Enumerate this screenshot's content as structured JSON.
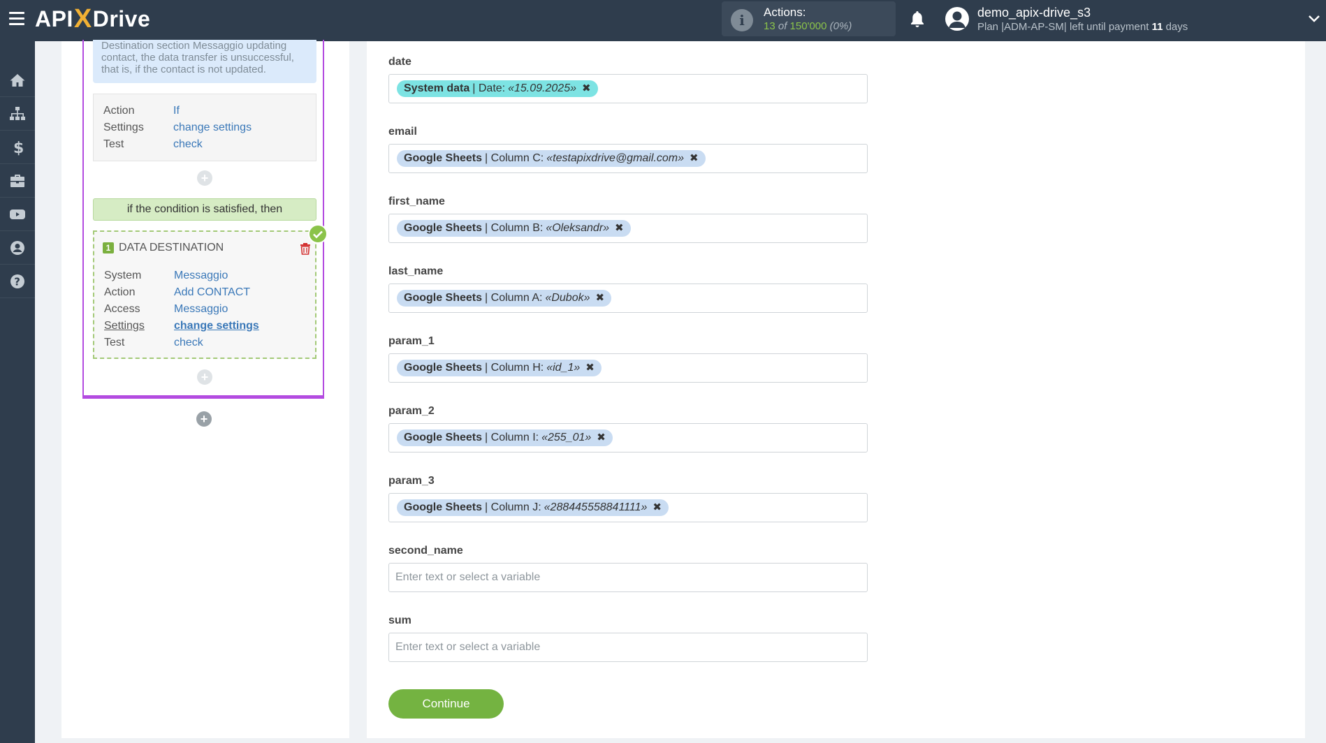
{
  "app": {
    "logo_main": "API",
    "logo_x": "X",
    "logo_tail": "Drive"
  },
  "header": {
    "actions_label": "Actions:",
    "actions_used": "13",
    "actions_of": "of",
    "actions_total": "150'000",
    "actions_pct": "(0%)",
    "user_name": "demo_apix-drive_s3",
    "plan_text": "Plan |ADM-AP-SM| left until payment",
    "plan_days": "11",
    "plan_days_suffix": "days"
  },
  "sidebar": {
    "items": [
      "home-icon",
      "sitemap-icon",
      "dollar-icon",
      "briefcase-icon",
      "youtube-icon",
      "user-icon",
      "help-icon"
    ]
  },
  "left_panel": {
    "note": "Destination section Messaggio updating contact, the data transfer is unsuccessful, that is, if the contact is not updated.",
    "filter_card": {
      "action_key": "Action",
      "action_val": "If",
      "settings_key": "Settings",
      "settings_val": "change settings",
      "test_key": "Test",
      "test_val": "check"
    },
    "condition": "if the condition is satisfied, then",
    "destination": {
      "number": "1",
      "title": "DATA DESTINATION",
      "system_key": "System",
      "system_val": "Messaggio",
      "action_key": "Action",
      "action_val": "Add CONTACT",
      "access_key": "Access",
      "access_val": "Messaggio",
      "settings_key": "Settings",
      "settings_val": "change settings",
      "test_key": "Test",
      "test_val": "check"
    }
  },
  "form": {
    "fields": [
      {
        "label": "date",
        "source": "System data",
        "detail": "| Date:",
        "value": "«15.09.2025»"
      },
      {
        "label": "email",
        "source": "Google Sheets",
        "detail": "| Column C:",
        "value": "«testapixdrive@gmail.com»"
      },
      {
        "label": "first_name",
        "source": "Google Sheets",
        "detail": "| Column B:",
        "value": "«Oleksandr»"
      },
      {
        "label": "last_name",
        "source": "Google Sheets",
        "detail": "| Column A:",
        "value": "«Dubok»"
      },
      {
        "label": "param_1",
        "source": "Google Sheets",
        "detail": "| Column H:",
        "value": "«id_1»"
      },
      {
        "label": "param_2",
        "source": "Google Sheets",
        "detail": "| Column I:",
        "value": "«255_01»"
      },
      {
        "label": "param_3",
        "source": "Google Sheets",
        "detail": "| Column J:",
        "value": "«288445558841111»"
      },
      {
        "label": "second_name",
        "placeholder": "Enter text or select a variable"
      },
      {
        "label": "sum",
        "placeholder": "Enter text or select a variable"
      }
    ],
    "continue_label": "Continue"
  },
  "colors": {
    "topbar": "#2f3d4d",
    "accent_green": "#74b341",
    "purple_border": "#b34be0",
    "chip_system": "#7de3e3",
    "chip_sheets": "#c9dcf2",
    "link_blue": "#3a78b8"
  }
}
